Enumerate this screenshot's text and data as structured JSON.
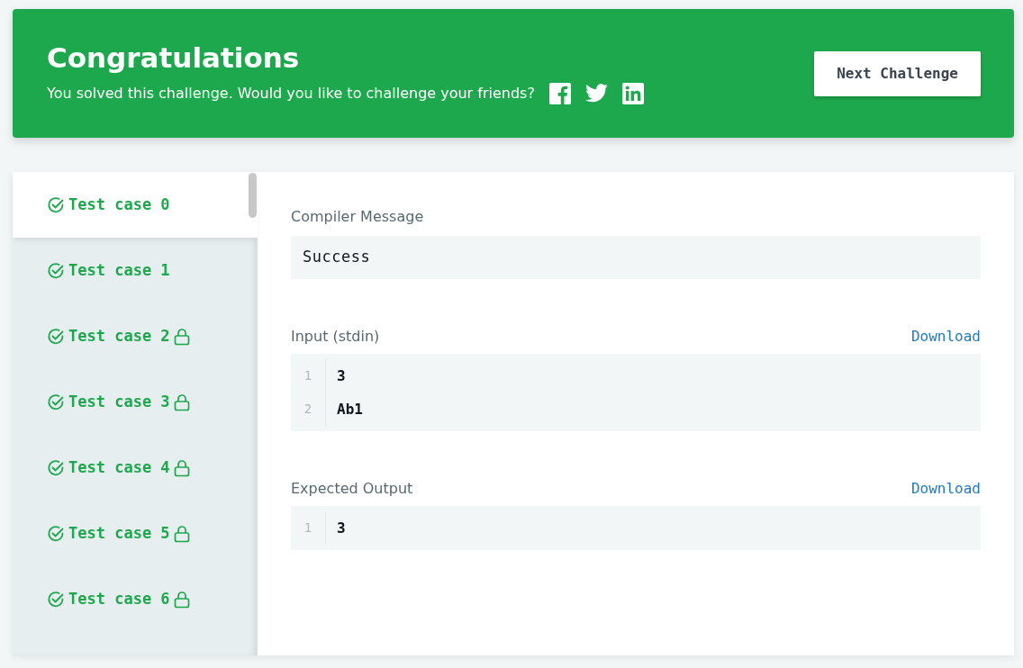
{
  "banner": {
    "title": "Congratulations",
    "message": "You solved this challenge. Would you like to challenge your friends?",
    "button": "Next Challenge"
  },
  "test_cases": [
    {
      "label": "Test case 0",
      "selected": true,
      "locked": false
    },
    {
      "label": "Test case 1",
      "selected": false,
      "locked": false
    },
    {
      "label": "Test case 2",
      "selected": false,
      "locked": true
    },
    {
      "label": "Test case 3",
      "selected": false,
      "locked": true
    },
    {
      "label": "Test case 4",
      "selected": false,
      "locked": true
    },
    {
      "label": "Test case 5",
      "selected": false,
      "locked": true
    },
    {
      "label": "Test case 6",
      "selected": false,
      "locked": true
    }
  ],
  "compiler": {
    "label": "Compiler Message",
    "value": "Success"
  },
  "sections": [
    {
      "label": "Input (stdin)",
      "link": "Download",
      "lines": [
        {
          "number": "1",
          "text": "3"
        },
        {
          "number": "2",
          "text": "Ab1"
        }
      ]
    },
    {
      "label": "Expected Output",
      "link": "Download",
      "lines": [
        {
          "number": "1",
          "text": "3"
        }
      ]
    }
  ]
}
